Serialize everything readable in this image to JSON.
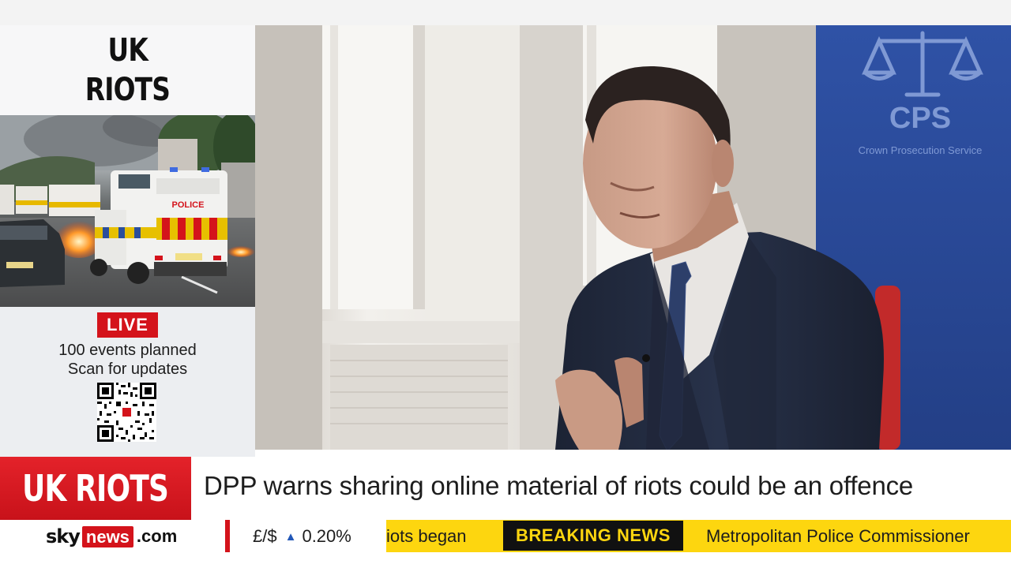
{
  "panel": {
    "title_line1": "UK",
    "title_line2": "RIOTS",
    "live_badge": "LIVE",
    "live_line1": "100 events planned",
    "live_line2": "Scan for updates",
    "photo_police_text": "POLICE"
  },
  "video": {
    "logo_text": "CPS",
    "logo_subtitle": "Crown Prosecution Service"
  },
  "lower_third": {
    "tag": "UK RIOTS",
    "headline": "DPP warns sharing online material of riots could be an offence"
  },
  "ticker": {
    "brand_sky": "sky",
    "brand_news": "news",
    "brand_com": ".com",
    "fx_pair": "£/$",
    "fx_direction": "up",
    "fx_value": "0.20%",
    "scroll_before": "iots began",
    "breaking_label": "BREAKING NEWS",
    "scroll_after": "Metropolitan Police Commissioner"
  },
  "colors": {
    "sky_red": "#d4131b",
    "ticker_yellow": "#fdd60f",
    "cps_blue": "#2c4c9a",
    "arrow_blue": "#2358b8"
  }
}
